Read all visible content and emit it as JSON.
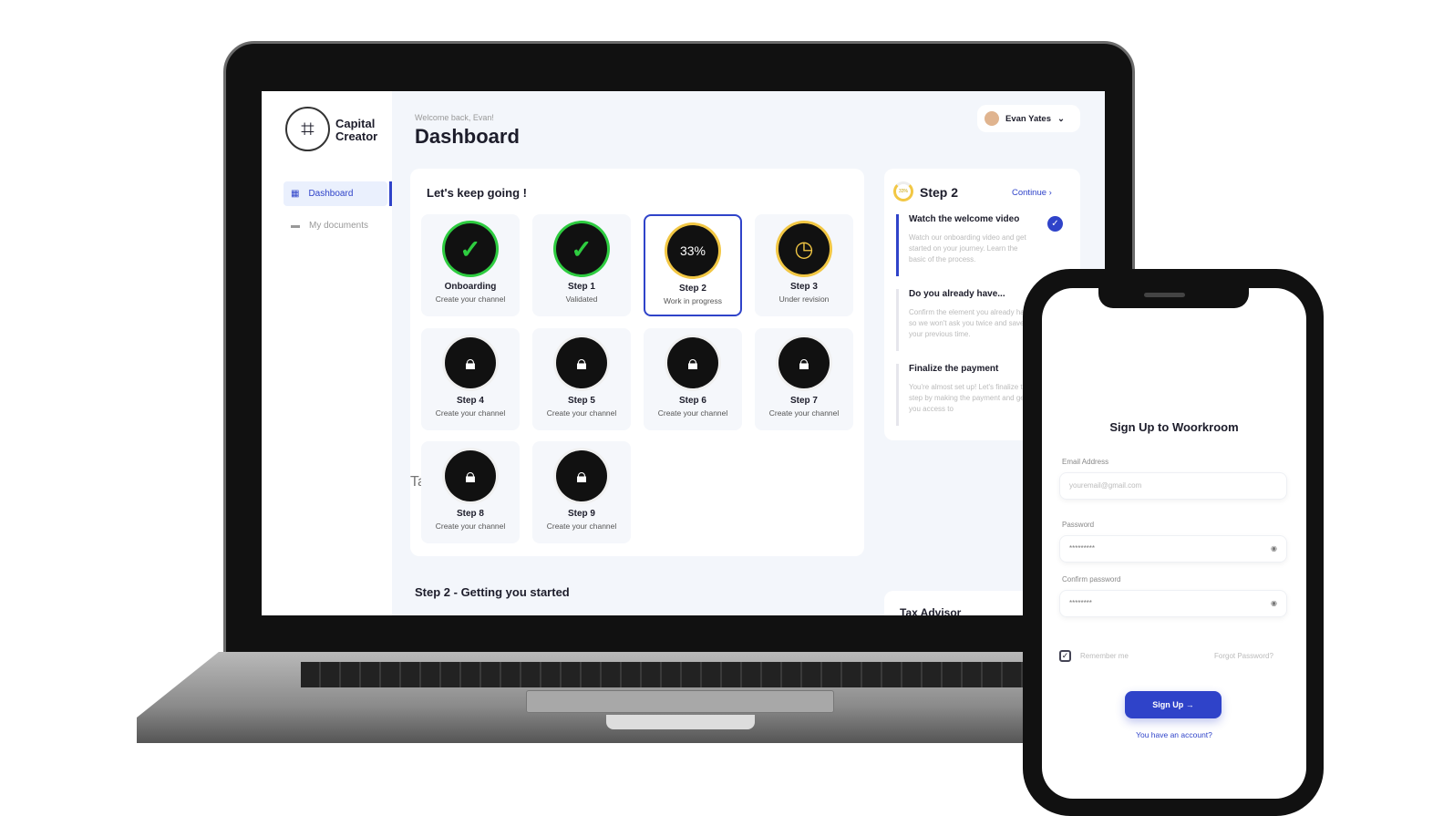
{
  "app": {
    "brand_line1": "Capital",
    "brand_line2": "Creator",
    "welcome": "Welcome back, Evan!",
    "title": "Dashboard",
    "user": "Evan Yates"
  },
  "sidebar": {
    "items": [
      {
        "label": "Dashboard",
        "icon": "grid-icon",
        "active": true
      },
      {
        "label": "My documents",
        "icon": "folder-icon",
        "active": false
      }
    ]
  },
  "progress": {
    "heading": "Let's keep going !",
    "tiles": [
      {
        "title": "Onboarding",
        "sub": "Create your channel",
        "state": "done"
      },
      {
        "title": "Step 1",
        "sub": "Validated",
        "state": "done"
      },
      {
        "title": "Step 2",
        "sub": "Work in progress",
        "state": "progress",
        "value": "33%"
      },
      {
        "title": "Step 3",
        "sub": "Under revision",
        "state": "revision"
      },
      {
        "title": "Step 4",
        "sub": "Create your channel",
        "state": "locked"
      },
      {
        "title": "Step 5",
        "sub": "Create your channel",
        "state": "locked"
      },
      {
        "title": "Step 6",
        "sub": "Create your channel",
        "state": "locked"
      },
      {
        "title": "Step 7",
        "sub": "Create your channel",
        "state": "locked"
      },
      {
        "title": "Step 8",
        "sub": "Create your channel",
        "state": "locked"
      },
      {
        "title": "Step 9",
        "sub": "Create your channel",
        "state": "locked"
      }
    ],
    "ghost": "Tasks"
  },
  "step_panel": {
    "progress": "33%",
    "title": "Step 2",
    "continue": "Continue",
    "items": [
      {
        "title": "Watch the welcome video",
        "text": "Watch our onboarding video and get started on your journey. Learn the basic of the process.",
        "done": true
      },
      {
        "title": "Do you already have...",
        "text": "Confirm the element you already have so we won't ask you twice and save your previous time."
      },
      {
        "title": "Finalize the payment",
        "text": "You're almost set up! Let's finalize this step by making the payment and get you access to"
      }
    ]
  },
  "section_title": "Step 2 - Getting you started",
  "tax_title": "Tax Advisor",
  "signup": {
    "title": "Sign Up to Woorkroom",
    "email_label": "Email Address",
    "email_placeholder": "youremail@gmail.com",
    "password_label": "Password",
    "password_value": "*********",
    "confirm_label": "Confirm password",
    "confirm_value": "********",
    "remember": "Remember me",
    "forgot": "Forgot Password?",
    "button": "Sign Up →",
    "account_link": "You have an account?"
  },
  "colors": {
    "accent": "#2f43c9",
    "done": "#2ecc40",
    "progress": "#f2c744"
  }
}
